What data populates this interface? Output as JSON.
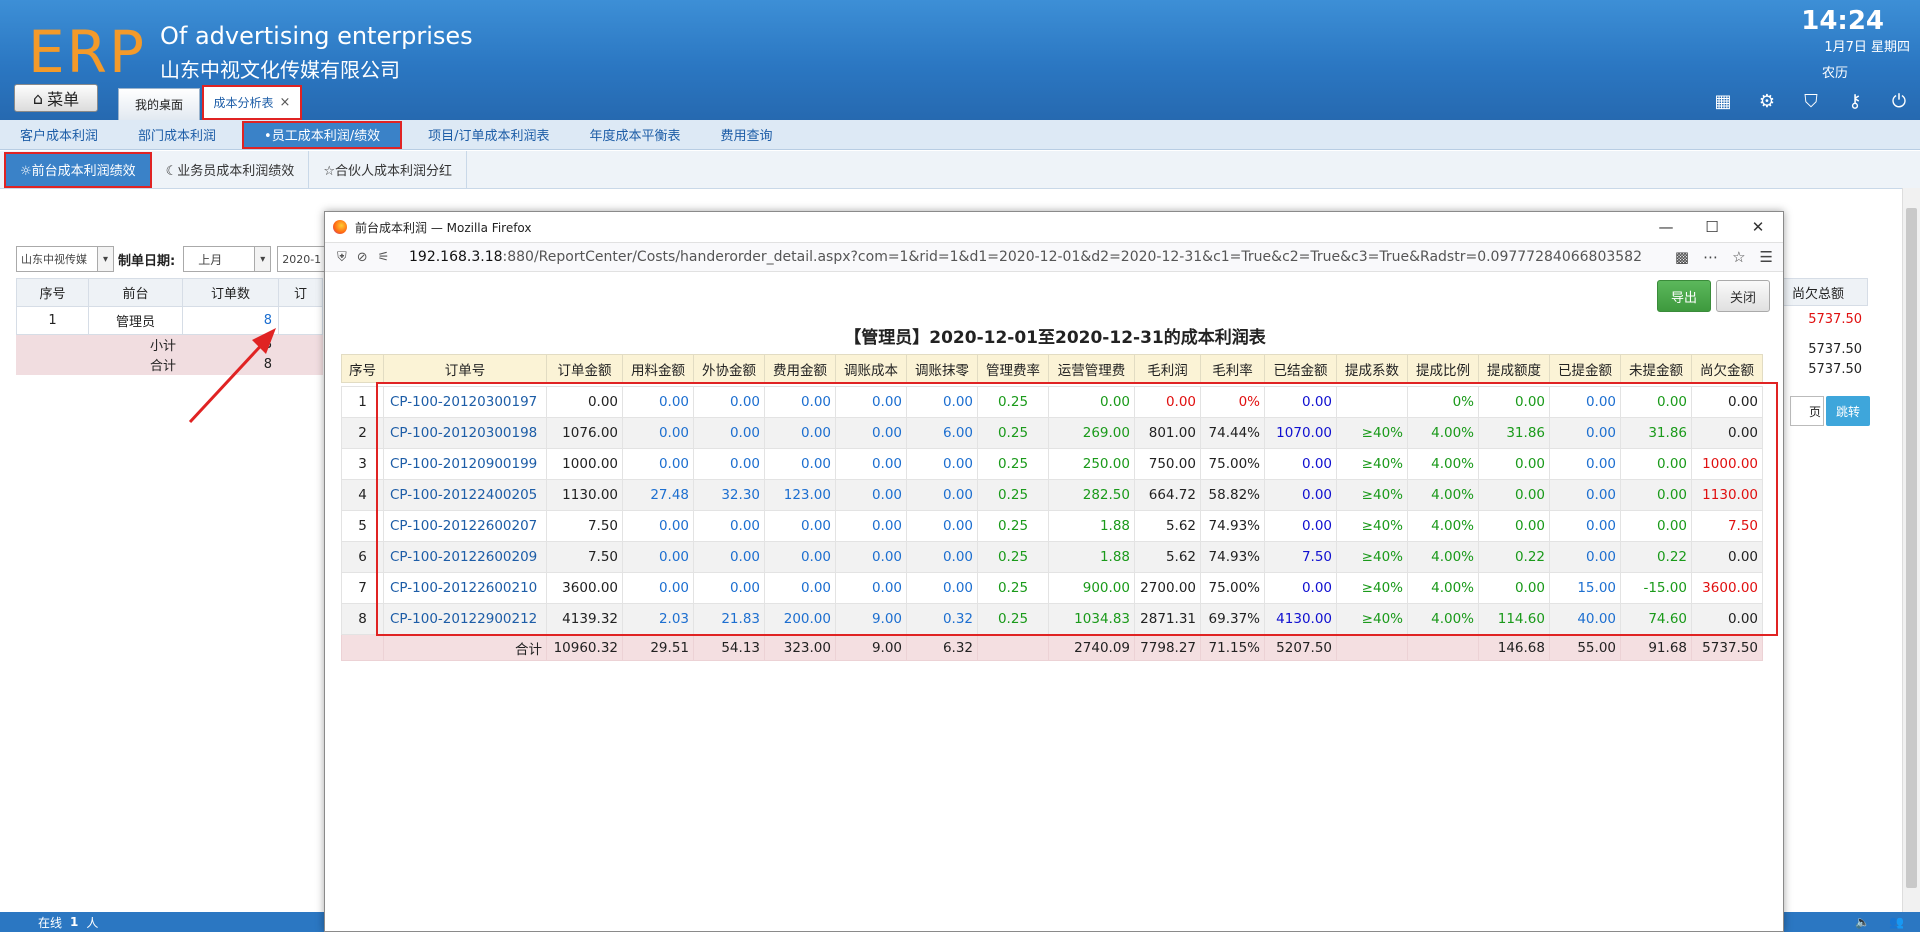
{
  "header": {
    "logo": "ERP",
    "brand_en": "Of advertising enterprises",
    "brand_cn": "山东中视文化传媒有限公司",
    "time": "14:24",
    "date": "1月7日 星期四",
    "lunar": "农历",
    "menu_label": "菜单",
    "tab_desktop": "我的桌面",
    "tab_active": "成本分析表",
    "tab_close": "×"
  },
  "subnav": [
    "客户成本利润",
    "部门成本利润",
    "•员工成本利润/绩效",
    "项目/订单成本利润表",
    "年度成本平衡表",
    "费用查询"
  ],
  "subnav2": [
    "☼前台成本利润绩效",
    "☾业务员成本利润绩效",
    "☆合伙人成本利润分红"
  ],
  "background": {
    "company_select": "山东中视传媒",
    "date_label": "制单日期:",
    "period_select": "上月",
    "date_start": "2020-1",
    "headers": [
      "序号",
      "前台",
      "订单数",
      "订"
    ],
    "row": {
      "no": "1",
      "name": "管理员",
      "count": "8"
    },
    "subtotal_label": "小计",
    "subtotal_value": "8",
    "total_label": "合计",
    "total_value": "8",
    "right_header": "尚欠总额",
    "right_row": "5737.50",
    "right_subtotal": "5737.50",
    "right_total": "5737.50",
    "page_suffix": "页",
    "jump": "跳转"
  },
  "status": {
    "online_label": "在线",
    "online_count": "1",
    "online_unit": "人"
  },
  "popup": {
    "title": "前台成本利润 — Mozilla Firefox",
    "url_host": "192.168.3.18",
    "url_rest": ":880/ReportCenter/Costs/handerorder_detail.aspx?com=1&rid=1&d1=2020-12-01&d2=2020-12-31&c1=True&c2=True&c3=True&Radstr=0.09777284066803582",
    "export_label": "导出",
    "close_label": "关闭",
    "report_title": "【管理员】2020-12-01至2020-12-31的成本利润表",
    "columns": [
      "序号",
      "订单号",
      "订单金额",
      "用料金额",
      "外协金额",
      "费用金额",
      "调账成本",
      "调账抹零",
      "管理费率",
      "运营管理费",
      "毛利润",
      "毛利率",
      "已结金额",
      "提成系数",
      "提成比例",
      "提成额度",
      "已提金额",
      "未提金额",
      "尚欠金额"
    ],
    "rows": [
      [
        "1",
        "CP-100-20120300197",
        "0.00",
        "0.00",
        "0.00",
        "0.00",
        "0.00",
        "0.00",
        "0.25",
        "0.00",
        "0.00",
        "0%",
        "0.00",
        "",
        "0%",
        "0.00",
        "0.00",
        "0.00",
        "0.00"
      ],
      [
        "2",
        "CP-100-20120300198",
        "1076.00",
        "0.00",
        "0.00",
        "0.00",
        "0.00",
        "6.00",
        "0.25",
        "269.00",
        "801.00",
        "74.44%",
        "1070.00",
        "≥40%",
        "4.00%",
        "31.86",
        "0.00",
        "31.86",
        "0.00"
      ],
      [
        "3",
        "CP-100-20120900199",
        "1000.00",
        "0.00",
        "0.00",
        "0.00",
        "0.00",
        "0.00",
        "0.25",
        "250.00",
        "750.00",
        "75.00%",
        "0.00",
        "≥40%",
        "4.00%",
        "0.00",
        "0.00",
        "0.00",
        "1000.00"
      ],
      [
        "4",
        "CP-100-20122400205",
        "1130.00",
        "27.48",
        "32.30",
        "123.00",
        "0.00",
        "0.00",
        "0.25",
        "282.50",
        "664.72",
        "58.82%",
        "0.00",
        "≥40%",
        "4.00%",
        "0.00",
        "0.00",
        "0.00",
        "1130.00"
      ],
      [
        "5",
        "CP-100-20122600207",
        "7.50",
        "0.00",
        "0.00",
        "0.00",
        "0.00",
        "0.00",
        "0.25",
        "1.88",
        "5.62",
        "74.93%",
        "0.00",
        "≥40%",
        "4.00%",
        "0.00",
        "0.00",
        "0.00",
        "7.50"
      ],
      [
        "6",
        "CP-100-20122600209",
        "7.50",
        "0.00",
        "0.00",
        "0.00",
        "0.00",
        "0.00",
        "0.25",
        "1.88",
        "5.62",
        "74.93%",
        "7.50",
        "≥40%",
        "4.00%",
        "0.22",
        "0.00",
        "0.22",
        "0.00"
      ],
      [
        "7",
        "CP-100-20122600210",
        "3600.00",
        "0.00",
        "0.00",
        "0.00",
        "0.00",
        "0.00",
        "0.25",
        "900.00",
        "2700.00",
        "75.00%",
        "0.00",
        "≥40%",
        "4.00%",
        "0.00",
        "15.00",
        "-15.00",
        "3600.00"
      ],
      [
        "8",
        "CP-100-20122900212",
        "4139.32",
        "2.03",
        "21.83",
        "200.00",
        "9.00",
        "0.32",
        "0.25",
        "1034.83",
        "2871.31",
        "69.37%",
        "4130.00",
        "≥40%",
        "4.00%",
        "114.60",
        "40.00",
        "74.60",
        "0.00"
      ]
    ],
    "total": [
      "",
      "合计",
      "10960.32",
      "29.51",
      "54.13",
      "323.00",
      "9.00",
      "6.32",
      "",
      "2740.09",
      "7798.27",
      "71.15%",
      "5207.50",
      "",
      "",
      "146.68",
      "55.00",
      "91.68",
      "5737.50"
    ]
  },
  "colors": {
    "header_blue": "#2b77c2",
    "logo_orange": "#f39a2a",
    "highlight_red": "#e02323",
    "export_green": "#4cae4c"
  }
}
